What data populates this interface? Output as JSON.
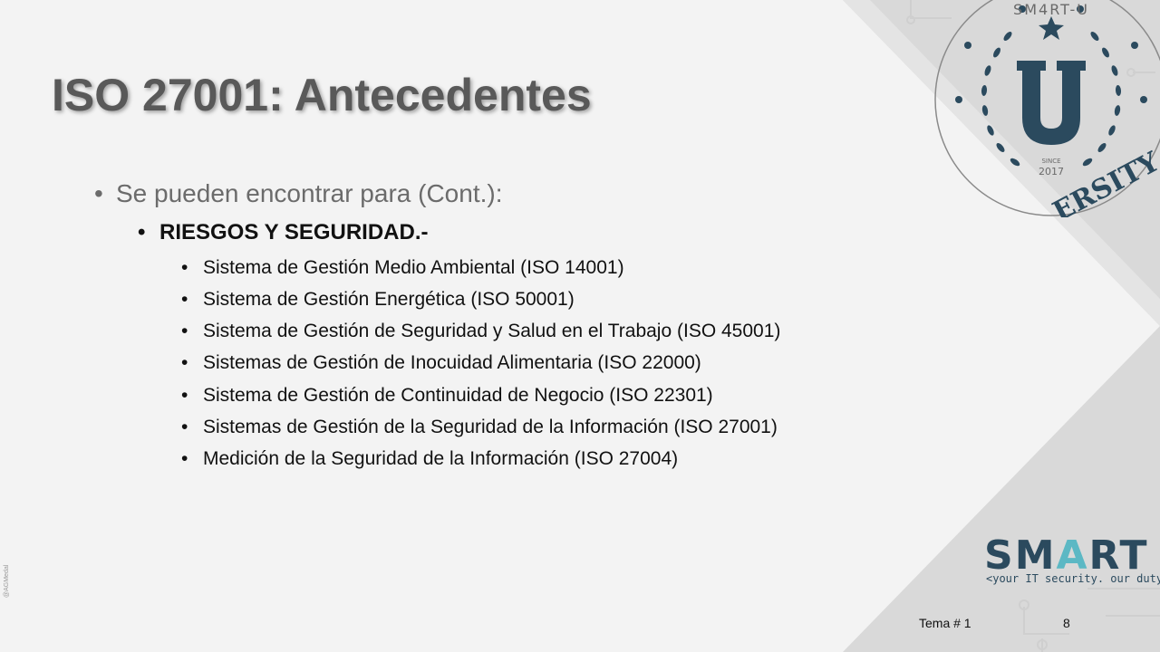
{
  "slide": {
    "title": "ISO 27001: Antecedentes",
    "level1": "Se pueden encontrar para (Cont.):",
    "level2": "RIESGOS Y SEGURIDAD.-",
    "level3": [
      "Sistema de Gestión Medio Ambiental (ISO 14001)",
      "Sistema de Gestión Energética (ISO 50001)",
      "Sistema de Gestión de Seguridad y Salud en el Trabajo (ISO 45001)",
      "Sistemas de Gestión de Inocuidad Alimentaria (ISO 22000)",
      "Sistema de Gestión de Continuidad de Negocio (ISO 22301)",
      "Sistemas de Gestión de  la Seguridad de la Información (ISO 27001)",
      "Medición de la Seguridad de la Información (ISO 27004)"
    ],
    "bullet": "•"
  },
  "logo": {
    "part1": "SM",
    "accent": "A",
    "part2": "RT",
    "tagline": "<your IT security. our duty|",
    "brand_color": "#2b4a5e",
    "accent_color": "#5cb8c4"
  },
  "seal": {
    "top_text": "SM4RT-U",
    "bottom_text": "ERSITY",
    "since_label": "SINCE",
    "since_year": "2017",
    "letter": "U"
  },
  "footer": {
    "tema": "Tema # 1",
    "page": "8"
  },
  "watermark": "@AGMedal"
}
